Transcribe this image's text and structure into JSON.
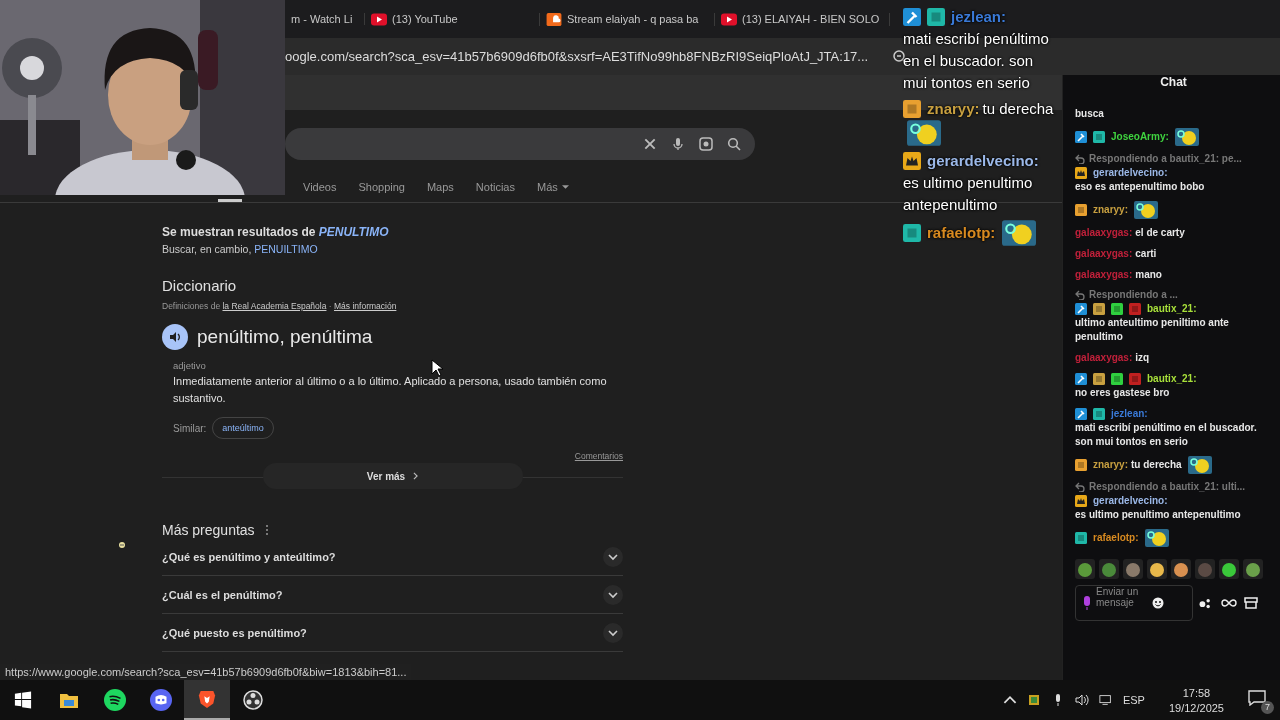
{
  "browser": {
    "tabs": [
      {
        "title": "m - Watch Li",
        "kind": "none",
        "selected": false
      },
      {
        "title": "(13) YouTube",
        "kind": "video",
        "selected": false
      },
      {
        "title": "Stream elaiyah - q pasa ba",
        "kind": "cloud",
        "selected": false
      },
      {
        "title": "(13) ELAIYAH - BIEN SOLO",
        "kind": "video",
        "selected": false
      }
    ],
    "address": "oogle.com/search?sca_esv=41b57b6909d6fb0f&sxsrf=AE3TifNo99hb8FNBzRI9SeiqPloAtJ_JTA:17..."
  },
  "search": {
    "nav": [
      {
        "label": "Videos"
      },
      {
        "label": "Shopping"
      },
      {
        "label": "Maps"
      },
      {
        "label": "Noticias"
      },
      {
        "label": "Más"
      }
    ]
  },
  "notice": {
    "prefix": "Se muestran resultados de",
    "term": "PENULTIMO",
    "alt_prefix": "Buscar, en cambio,",
    "alt_term": "PENUILTIMO"
  },
  "dictionary": {
    "title": "Diccionario",
    "source_prefix": "Definiciones de",
    "source_link": "la Real Academia Española",
    "separator": "·",
    "info_link": "Más información",
    "word": "penúltimo, penúltima",
    "pos": "adjetivo",
    "definition": "Inmediatamente anterior al último o a lo último. Aplicado a persona, usado también como sustantivo.",
    "similar_label": "Similar:",
    "similar": [
      "anteúltimo"
    ],
    "feedback": "Comentarios",
    "more": "Ver más"
  },
  "questions": {
    "title": "Más preguntas",
    "items": [
      {
        "text": "¿Qué es penúltimo y anteúltimo?",
        "expanded": false
      },
      {
        "text": "¿Cuál es el penúltimo?",
        "expanded": false
      },
      {
        "text": "¿Qué puesto es penúltimo?",
        "expanded": false
      }
    ]
  },
  "status_url": "https://www.google.com/search?sca_esv=41b57b6909d6fb0f&biw=1813&bih=81...",
  "overlay": {
    "messages": [
      {
        "user": "jezlean:",
        "color": "#3a7ad8",
        "badges": [
          {
            "kind": "mod"
          },
          {
            "kind": "sub"
          }
        ],
        "text": "mati escribí penúltimo en el buscador. son mui tontos en serio",
        "emote": false
      },
      {
        "user": "znaryy:",
        "color": "#c8a040",
        "badges": [
          {
            "kind": "stv"
          }
        ],
        "text": "tu derecha",
        "emote": true
      },
      {
        "user": "gerardelvecino:",
        "color": "#9bb8e8",
        "badges": [
          {
            "kind": "crown"
          }
        ],
        "text": "es ultimo penultimo antepenultimo",
        "emote": false
      },
      {
        "user": "rafaelotp:",
        "color": "#d88a20",
        "badges": [
          {
            "kind": "sub"
          }
        ],
        "emote": true
      }
    ]
  },
  "chat": {
    "title": "Chat",
    "placeholder": "Enviar un mensaje",
    "messages": [
      {
        "kind": "fragment",
        "text": "busca"
      },
      {
        "kind": "message",
        "user": "JoseoArmy:",
        "color": "#3fd33f",
        "badges": [
          {
            "kind": "mod"
          },
          {
            "kind": "sub"
          }
        ],
        "emote": true
      },
      {
        "kind": "reply",
        "text": "Respondiendo a bautix_21: pe..."
      },
      {
        "kind": "message",
        "user": "gerardelvecino:",
        "color": "#9bb8e8",
        "badges": [
          {
            "kind": "crown"
          }
        ],
        "text": "eso es antepenultimo bobo",
        "emote": false
      },
      {
        "kind": "message",
        "user": "znaryy:",
        "color": "#c8a040",
        "badges": [
          {
            "kind": "stv"
          }
        ],
        "emote": true
      },
      {
        "kind": "message",
        "user": "galaaxygas:",
        "color": "#c0203a",
        "text": "el de carty",
        "emote": false
      },
      {
        "kind": "message",
        "user": "galaaxygas:",
        "color": "#c0203a",
        "text": "carti",
        "emote": false
      },
      {
        "kind": "message",
        "user": "galaaxygas:",
        "color": "#c0203a",
        "text": "mano",
        "emote": false
      },
      {
        "kind": "reply",
        "text": "Respondiendo a ..."
      },
      {
        "kind": "message",
        "user": "bautix_21:",
        "color": "#a8e03a",
        "badges": [
          {
            "kind": "mod"
          },
          {
            "kind": "gold"
          },
          {
            "kind": "gift"
          },
          {
            "kind": "red"
          }
        ],
        "text": "ultimo anteultimo peniltimo ante penultimo",
        "emote": false
      },
      {
        "kind": "message",
        "user": "galaaxygas:",
        "color": "#c0203a",
        "text": "izq",
        "emote": false
      },
      {
        "kind": "message",
        "user": "bautix_21:",
        "color": "#a8e03a",
        "badges": [
          {
            "kind": "mod"
          },
          {
            "kind": "gold"
          },
          {
            "kind": "gift"
          },
          {
            "kind": "red"
          }
        ],
        "text": "no eres gastese bro",
        "emote": false
      },
      {
        "kind": "message",
        "user": "jezlean:",
        "color": "#3a7ad8",
        "badges": [
          {
            "kind": "mod"
          },
          {
            "kind": "sub"
          }
        ],
        "text": "mati escribí penúltimo en el buscador. son mui tontos en serio",
        "emote": false
      },
      {
        "kind": "message",
        "user": "znaryy:",
        "color": "#c8a040",
        "badges": [
          {
            "kind": "stv"
          }
        ],
        "text": "tu derecha",
        "emote": true
      },
      {
        "kind": "reply",
        "text": "Respondiendo a bautix_21: ulti..."
      },
      {
        "kind": "message",
        "user": "gerardelvecino:",
        "color": "#9bb8e8",
        "badges": [
          {
            "kind": "crown"
          }
        ],
        "text": "es ultimo penultimo antepenultimo",
        "emote": false
      },
      {
        "kind": "message",
        "user": "rafaelotp:",
        "color": "#d88a20",
        "badges": [
          {
            "kind": "sub"
          }
        ],
        "emote": true
      }
    ]
  },
  "taskbar": {
    "apps": [
      {
        "kind": "start",
        "selected": false
      },
      {
        "kind": "folder",
        "selected": false
      },
      {
        "kind": "music",
        "selected": false
      },
      {
        "kind": "chat",
        "selected": false
      },
      {
        "kind": "lion",
        "selected": true
      },
      {
        "kind": "record",
        "selected": false
      }
    ],
    "language": "ESP",
    "time": "17:58",
    "date": "19/12/2025",
    "notifications": "7"
  }
}
